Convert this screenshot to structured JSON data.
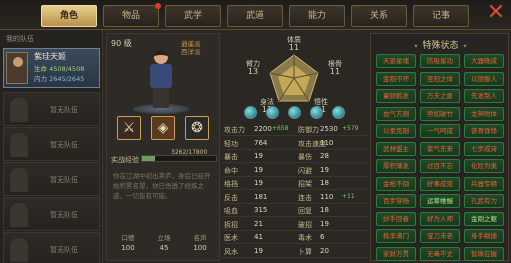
{
  "tabs": [
    {
      "label": "角色",
      "active": true
    },
    {
      "label": "物品",
      "active": false,
      "alert": true
    },
    {
      "label": "武学",
      "active": false
    },
    {
      "label": "武道",
      "active": false
    },
    {
      "label": "能力",
      "active": false
    },
    {
      "label": "关系",
      "active": false
    },
    {
      "label": "记事",
      "active": false
    }
  ],
  "close_label": "✕",
  "team": {
    "title": "我的队伍",
    "member": {
      "name": "紫珪天姬",
      "hp": "生命 4508/4508",
      "mp": "内力 2645/2645"
    },
    "empty_label": "暂无队伍",
    "empty_count": 5
  },
  "character": {
    "level": "90 级",
    "title_primary": "逍遥派",
    "title_secondary": "西洋派",
    "exp_label": "实战经验",
    "exp_value": "3262/17800",
    "exp_fraction": 0.18,
    "description": "你在江湖中初出茅庐，身后已经开始积累名望，你已悟透了修炼之道，一切皆有可能。",
    "equip_icons": [
      "sword-icon",
      "armor-icon",
      "accessory-icon"
    ],
    "base_stats": [
      {
        "label": "口德",
        "value": "100"
      },
      {
        "label": "立场",
        "value": "45"
      },
      {
        "label": "名声",
        "value": "100"
      }
    ]
  },
  "attributes": {
    "体质": {
      "label": "体质",
      "value": "11"
    },
    "根骨": {
      "label": "根骨",
      "value": "11"
    },
    "身法": {
      "label": "身法",
      "value": "11"
    },
    "悟性": {
      "label": "悟性",
      "value": "11"
    },
    "臂力": {
      "label": "臂力",
      "value": "13"
    }
  },
  "orb_count": 5,
  "stats": [
    {
      "k": "攻击力",
      "v": "2200",
      "a": "+658",
      "k2": "防御力",
      "v2": "2530",
      "a2": "+579"
    },
    {
      "k": "轻功",
      "v": "764",
      "a": "",
      "k2": "攻击速度",
      "v2": "110",
      "a2": ""
    },
    {
      "k": "暴击",
      "v": "19",
      "a": "",
      "k2": "暴伤",
      "v2": "28",
      "a2": ""
    },
    {
      "k": "命中",
      "v": "19",
      "a": "",
      "k2": "闪避",
      "v2": "19",
      "a2": ""
    },
    {
      "k": "格挡",
      "v": "19",
      "a": "",
      "k2": "招架",
      "v2": "18",
      "a2": ""
    },
    {
      "k": "反击",
      "v": "181",
      "a": "",
      "k2": "连击",
      "v2": "110",
      "a2": "+11"
    },
    {
      "k": "吸血",
      "v": "315",
      "a": "",
      "k2": "回复",
      "v2": "18",
      "a2": ""
    },
    {
      "k": "拆招",
      "v": "21",
      "a": "",
      "k2": "破招",
      "v2": "19",
      "a2": ""
    },
    {
      "k": "医术",
      "v": "41",
      "a": "",
      "k2": "毒术",
      "v2": "6",
      "a2": ""
    },
    {
      "k": "风水",
      "v": "19",
      "a": "",
      "k2": "卜算",
      "v2": "20",
      "a2": ""
    }
  ],
  "special_states": {
    "title": "特殊状态",
    "badges": [
      {
        "label": "天狼星魂",
        "green": false
      },
      {
        "label": "防吸星功",
        "green": false
      },
      {
        "label": "大器晚成",
        "green": false
      },
      {
        "label": "金刚不坏",
        "green": false
      },
      {
        "label": "至阳之体",
        "green": false
      },
      {
        "label": "以德服人",
        "green": false
      },
      {
        "label": "童颜鹤发",
        "green": false
      },
      {
        "label": "万夫之勇",
        "green": false
      },
      {
        "label": "先发制人",
        "green": false
      },
      {
        "label": "血气方刚",
        "green": false
      },
      {
        "label": "势如破竹",
        "green": false
      },
      {
        "label": "龙神附体",
        "green": false
      },
      {
        "label": "以柔克刚",
        "green": false
      },
      {
        "label": "一气呵成",
        "green": false
      },
      {
        "label": "铁骨铮铮",
        "green": false
      },
      {
        "label": "武林盟主",
        "green": false
      },
      {
        "label": "紫气东来",
        "green": false
      },
      {
        "label": "七步成诗",
        "green": false
      },
      {
        "label": "厚积薄发",
        "green": false
      },
      {
        "label": "过目不忘",
        "green": false
      },
      {
        "label": "化险为夷",
        "green": false
      },
      {
        "label": "金枪不倒",
        "green": false
      },
      {
        "label": "好事成双",
        "green": false
      },
      {
        "label": "兵器专精",
        "green": false
      },
      {
        "label": "百步穿杨",
        "green": false
      },
      {
        "label": "运筹帷幄",
        "green": true
      },
      {
        "label": "孔武有力",
        "green": false
      },
      {
        "label": "妙手回春",
        "green": false
      },
      {
        "label": "好为人师",
        "green": false
      },
      {
        "label": "金刚之躯",
        "green": true
      },
      {
        "label": "桃李满门",
        "green": false
      },
      {
        "label": "宝刀未老",
        "green": false
      },
      {
        "label": "身手敏捷",
        "green": false
      },
      {
        "label": "家财万贯",
        "green": false
      },
      {
        "label": "无毒不丈",
        "green": false
      },
      {
        "label": "智珠在握",
        "green": false
      }
    ]
  },
  "colors": {
    "accent": "#e8cf8e",
    "green_badge_border": "#2d7a3a",
    "badge_text": "#e8603a"
  }
}
